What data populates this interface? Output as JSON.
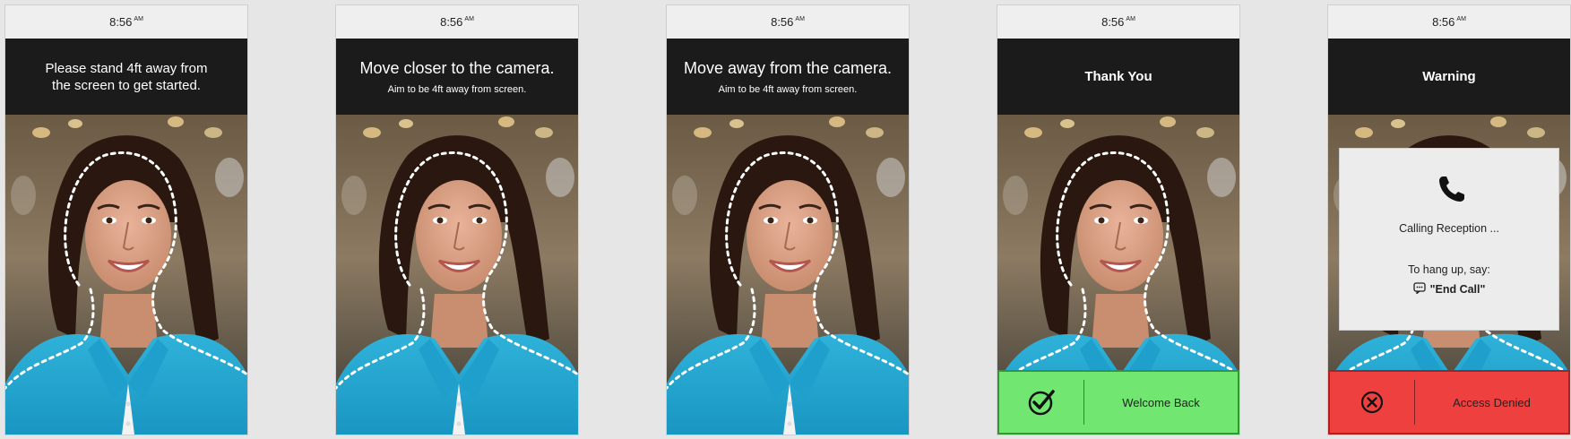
{
  "screens": [
    {
      "status_time": "8:56",
      "status_ampm": "AM",
      "header_line1": "Please stand 4ft away from",
      "header_line2": "the screen to get started."
    },
    {
      "status_time": "8:56",
      "status_ampm": "AM",
      "header_title": "Move closer to the camera.",
      "header_subtitle": "Aim to be 4ft away from screen."
    },
    {
      "status_time": "8:56",
      "status_ampm": "AM",
      "header_title": "Move away from the camera.",
      "header_subtitle": "Aim to be 4ft away from screen."
    },
    {
      "status_time": "8:56",
      "status_ampm": "AM",
      "header_title": "Thank You",
      "result": {
        "text": "Welcome Back",
        "icon": "checkmark-circle-icon",
        "color": "#71e671"
      }
    },
    {
      "status_time": "8:56",
      "status_ampm": "AM",
      "header_title": "Warning",
      "dialog": {
        "status": "Calling Reception ...",
        "hangup_label": "To hang up, say:",
        "hangup_command": "\"End Call\"",
        "icons": [
          "phone-icon",
          "speech-bubble-icon"
        ]
      },
      "result": {
        "text": "Access Denied",
        "icon": "close-circle-icon",
        "color": "#ef4040"
      }
    }
  ]
}
